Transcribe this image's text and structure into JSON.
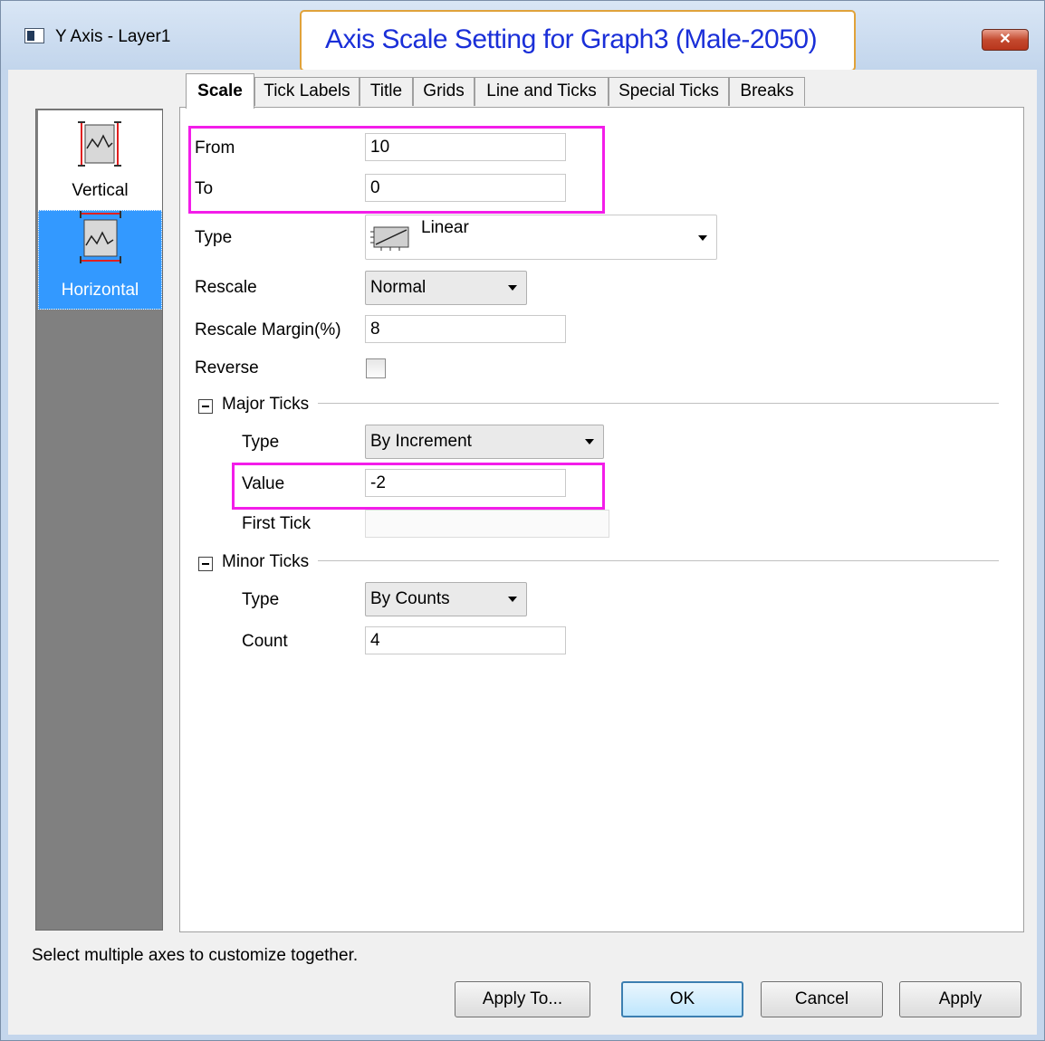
{
  "window": {
    "title": "Y Axis - Layer1"
  },
  "annotation": {
    "text": "Axis Scale Setting for Graph3 (Male-2050)"
  },
  "sidebar": {
    "items": [
      {
        "label": "Vertical",
        "icon": "vertical-axis-icon",
        "selected": false
      },
      {
        "label": "Horizontal",
        "icon": "horizontal-axis-icon",
        "selected": true
      }
    ]
  },
  "tabs": [
    "Scale",
    "Tick Labels",
    "Title",
    "Grids",
    "Line and Ticks",
    "Special Ticks",
    "Breaks"
  ],
  "active_tab": "Scale",
  "scale": {
    "from_label": "From",
    "from_value": "10",
    "to_label": "To",
    "to_value": "0",
    "type_label": "Type",
    "type_value": "Linear",
    "rescale_label": "Rescale",
    "rescale_value": "Normal",
    "margin_label": "Rescale Margin(%)",
    "margin_value": "8",
    "reverse_label": "Reverse",
    "reverse_checked": false
  },
  "major_ticks": {
    "title": "Major Ticks",
    "type_label": "Type",
    "type_value": "By Increment",
    "value_label": "Value",
    "value_value": "-2",
    "first_label": "First Tick",
    "first_value": ""
  },
  "minor_ticks": {
    "title": "Minor Ticks",
    "type_label": "Type",
    "type_value": "By Counts",
    "count_label": "Count",
    "count_value": "4"
  },
  "status_text": "Select multiple axes to customize together.",
  "buttons": {
    "apply_to": "Apply To...",
    "ok": "OK",
    "cancel": "Cancel",
    "apply": "Apply"
  },
  "colors": {
    "highlight": "#f31de9",
    "annotation_text": "#1a2fd8",
    "annotation_border": "#e0a23a",
    "selection": "#3399ff"
  }
}
